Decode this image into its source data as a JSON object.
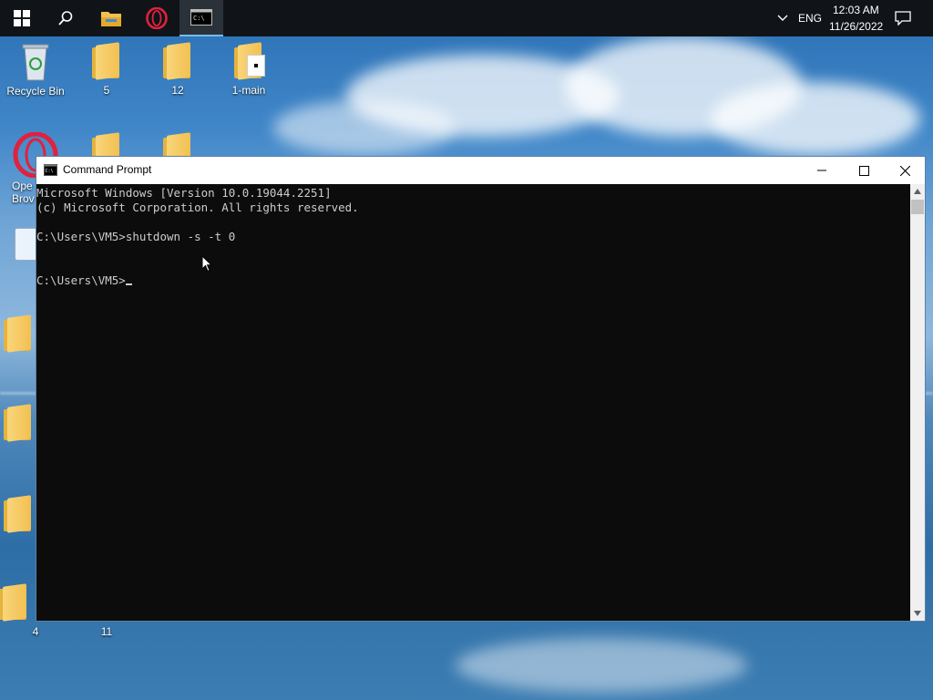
{
  "taskbar": {
    "apps": [
      {
        "name": "start",
        "active": false
      },
      {
        "name": "search",
        "active": false
      },
      {
        "name": "file-explorer",
        "active": false
      },
      {
        "name": "opera",
        "active": false
      },
      {
        "name": "command-prompt",
        "active": true
      }
    ],
    "language": "ENG",
    "time": "12:03 AM",
    "date": "11/26/2022"
  },
  "desktop": {
    "icons": [
      {
        "label": "Recycle Bin",
        "kind": "recycle-bin"
      },
      {
        "label": "5",
        "kind": "folder"
      },
      {
        "label": "12",
        "kind": "folder"
      },
      {
        "label": "1-main",
        "kind": "folder-doc"
      },
      {
        "label": "Ope",
        "kind": "opera-shortcut"
      },
      {
        "label": "Brov",
        "kind": "opera-shortcut"
      },
      {
        "label": "4",
        "kind": "folder"
      },
      {
        "label": "11",
        "kind": "folder"
      }
    ]
  },
  "cmd": {
    "title": "Command Prompt",
    "lines": [
      "Microsoft Windows [Version 10.0.19044.2251]",
      "(c) Microsoft Corporation. All rights reserved.",
      "",
      "C:\\Users\\VM5>shutdown -s -t 0",
      "",
      "",
      "C:\\Users\\VM5>"
    ]
  },
  "colors": {
    "taskbar_bg": "#101418",
    "terminal_bg": "#0c0c0c",
    "terminal_fg": "#cccccc",
    "accent": "#76b9ed"
  }
}
